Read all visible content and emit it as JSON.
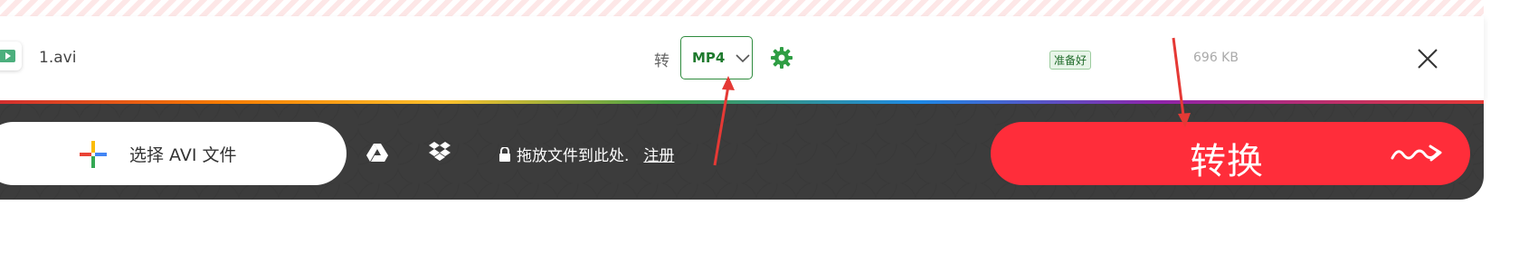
{
  "file_row": {
    "file_name": "1.avi",
    "to_label": "转",
    "format": "MP4",
    "status": "准备好",
    "file_size": "696 KB"
  },
  "toolbar": {
    "choose_label": "选择 AVI 文件",
    "drop_text": "拖放文件到此处.",
    "signup_label": "注册",
    "convert_label": "转换"
  },
  "icons": {
    "file": "video-file-icon",
    "settings": "gear-icon",
    "close": "close-icon",
    "chevron": "chevron-down-icon",
    "plus": "colorful-plus-icon",
    "gdrive": "google-drive-icon",
    "dropbox": "dropbox-icon",
    "lock": "lock-icon",
    "convert_arrow": "squiggle-arrow-icon"
  },
  "colors": {
    "accent_green": "#1f7a2e",
    "convert_red": "#ff2d3a",
    "toolbar_dark": "#3c3c3c",
    "annotation_red": "#e53935"
  }
}
